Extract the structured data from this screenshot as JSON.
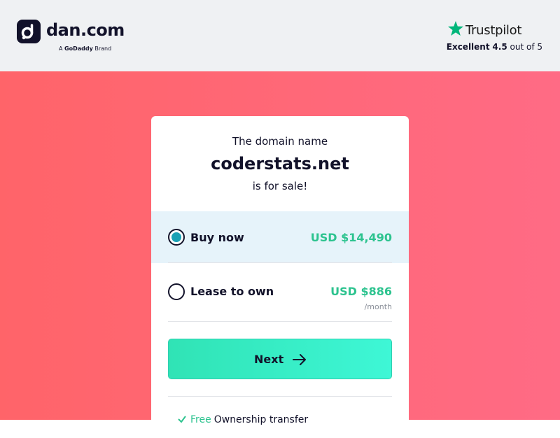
{
  "header": {
    "logo_text": "dan.com",
    "logo_sub_prefix": "A",
    "logo_sub_brand": "GoDaddy",
    "logo_sub_suffix": "Brand",
    "trustpilot": {
      "name": "Trustpilot",
      "rating_label": "Excellent",
      "rating_value": "4.5",
      "rating_suffix": "out of 5",
      "star_color": "#00b67a"
    }
  },
  "card": {
    "intro": "The domain name",
    "domain": "coderstats.net",
    "for_sale": "is for sale!",
    "options": [
      {
        "label": "Buy now",
        "price": "USD $14,490",
        "per": "",
        "selected": true
      },
      {
        "label": "Lease to own",
        "price": "USD $886",
        "per": "/month",
        "selected": false
      }
    ],
    "next_label": "Next",
    "footer": {
      "free": "Free",
      "text": "Ownership transfer"
    }
  },
  "colors": {
    "accent_green": "#2dc38f",
    "selected_bg": "#e6f3fa",
    "radio_fill": "#1aa1b5",
    "hero_left": "#ff6469",
    "hero_right": "#ff6b85"
  }
}
